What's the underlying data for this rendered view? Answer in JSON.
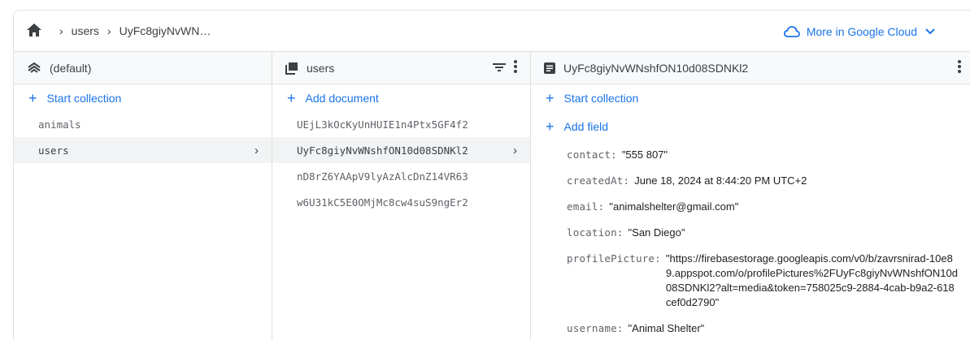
{
  "breadcrumb": {
    "items": [
      "users",
      "UyFc8giyNvWN…"
    ]
  },
  "header": {
    "more_cloud_label": "More in Google Cloud"
  },
  "columns": {
    "root": {
      "title": "(default)",
      "start_collection_label": "Start collection",
      "items": [
        {
          "label": "animals",
          "selected": false
        },
        {
          "label": "users",
          "selected": true
        }
      ]
    },
    "collection": {
      "title": "users",
      "add_document_label": "Add document",
      "items": [
        {
          "label": "UEjL3kOcKyUnHUIE1n4Ptx5GF4f2",
          "selected": false
        },
        {
          "label": "UyFc8giyNvWNshfON10d08SDNKl2",
          "selected": true
        },
        {
          "label": "nD8rZ6YAApV9lyAzAlcDnZ14VR63",
          "selected": false
        },
        {
          "label": "w6U31kC5E0OMjMc8cw4suS9ngEr2",
          "selected": false
        }
      ]
    },
    "document": {
      "title": "UyFc8giyNvWNshfON10d08SDNKl2",
      "start_collection_label": "Start collection",
      "add_field_label": "Add field",
      "fields": [
        {
          "key": "contact:",
          "value": "\"555 807\""
        },
        {
          "key": "createdAt:",
          "value": "June 18, 2024 at 8:44:20 PM UTC+2"
        },
        {
          "key": "email:",
          "value": "\"animalshelter@gmail.com\""
        },
        {
          "key": "location:",
          "value": "\"San Diego\""
        },
        {
          "key": "profilePicture:",
          "value": "\"https://firebasestorage.googleapis.com/v0/b/zavrsnirad-10e89.appspot.com/o/profilePictures%2FUyFc8giyNvWNshfON10d08SDNKl2?alt=media&token=758025c9-2884-4cab-b9a2-618cef0d2790\""
        },
        {
          "key": "username:",
          "value": "\"Animal Shelter\""
        }
      ]
    }
  },
  "colors": {
    "accent": "#1a73e8",
    "selected_bg": "#f1f3f4",
    "header_bg": "#f8f9fa"
  }
}
